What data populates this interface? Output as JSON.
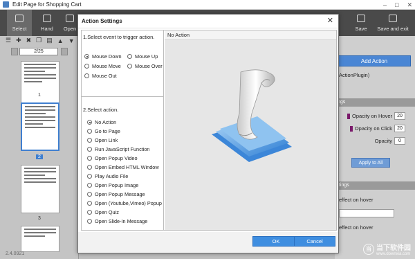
{
  "window": {
    "title": "Edit Page for Shopping Cart",
    "minimize": "–",
    "maximize": "□",
    "close": "✕"
  },
  "toolbar": {
    "select": "Select",
    "hand": "Hand",
    "open": "Open",
    "save": "Save",
    "save_exit": "Save and exit"
  },
  "left_panel": {
    "page_indicator": "2/25",
    "thumb_labels": [
      "1",
      "2",
      "3"
    ],
    "status": "2.4.0921"
  },
  "right_panel": {
    "add_action": "Add Action",
    "plugin_text": "ActionPlugin)",
    "section_settings": "ngs",
    "opacity_hover_label": "Opacity on Hover",
    "opacity_hover_value": "20",
    "opacity_click_label": "Opacity on Click",
    "opacity_click_value": "20",
    "opacity_label": "Opacity",
    "opacity_value": "0",
    "apply_to_all": "Apply to All",
    "section_effects": "ttings",
    "effect_hover_1": "effect on hover",
    "effect_hover_2": "effect on hover"
  },
  "dialog": {
    "title": "Action Settings",
    "section1": "1.Select event to trigger action.",
    "events": [
      {
        "label": "Mouse Down",
        "selected": true
      },
      {
        "label": "Mouse Up",
        "selected": false
      },
      {
        "label": "Mouse Move",
        "selected": false
      },
      {
        "label": "Mouse Over",
        "selected": false
      },
      {
        "label": "Mouse Out",
        "selected": false
      }
    ],
    "section2": "2.Select action.",
    "actions": [
      {
        "label": "No Action",
        "selected": true
      },
      {
        "label": "Go to Page",
        "selected": false
      },
      {
        "label": "Open Link",
        "selected": false
      },
      {
        "label": "Run JavaScript Function",
        "selected": false
      },
      {
        "label": "Open Popup Video",
        "selected": false
      },
      {
        "label": "Open Embed HTML Window",
        "selected": false
      },
      {
        "label": "Play Audio File",
        "selected": false
      },
      {
        "label": "Open Popup Image",
        "selected": false
      },
      {
        "label": "Open Popup Message",
        "selected": false
      },
      {
        "label": "Open (Youtube,Vimeo) Popup",
        "selected": false
      },
      {
        "label": "Open Quiz",
        "selected": false
      },
      {
        "label": "Open Slide-In Message",
        "selected": false
      }
    ],
    "preview_title": "No Action",
    "ok": "OK",
    "cancel": "Cancel"
  },
  "watermark": {
    "logo_text": "当",
    "main": "当下软件园",
    "sub": "www.downxia.com"
  },
  "colors": {
    "accent": "#3f8ee0",
    "toolbar": "#4a4a4a",
    "dialog_bg": "#ffffff"
  }
}
